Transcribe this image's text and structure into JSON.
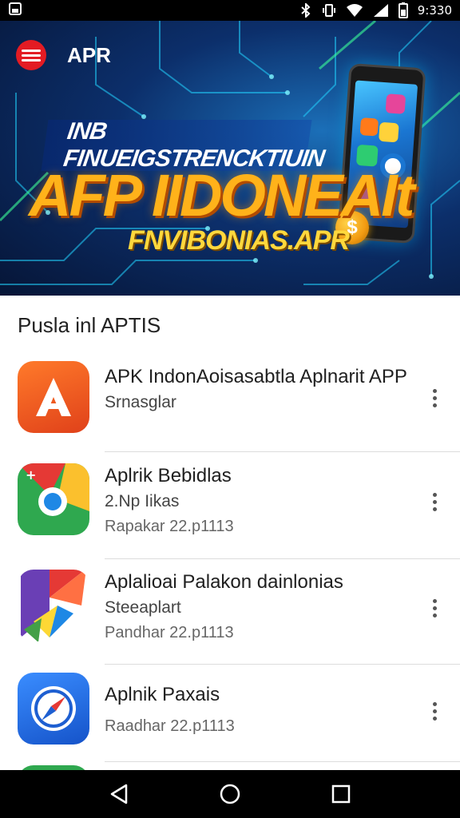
{
  "status_bar": {
    "time": "9:330",
    "icons": [
      "screenshot-icon",
      "bluetooth-icon",
      "vibrate-icon",
      "wifi-icon",
      "signal-icon",
      "battery-icon"
    ]
  },
  "hero": {
    "app_title": "APR",
    "line1": "INB FINUEIGSTRENCKTIUIN",
    "line2": "AFP IIDONEAIt",
    "line3": "FNVIBONIAS.APR",
    "accent_color": "#ffb21a",
    "logo_color": "#e31b23"
  },
  "section": {
    "title": "Pusla inl APTIS"
  },
  "apps": [
    {
      "name": "APK IndonAoisasabtla Aplnarit APP",
      "subtitle": "Srnasglar",
      "date": "",
      "icon": "apk-a-icon"
    },
    {
      "name": "Aplrik Bebidlas",
      "subtitle": "2.Np Iikas",
      "date": "Rapakar 22.p1113",
      "icon": "chrome-like-icon"
    },
    {
      "name": "Aplalioai Palakon dainlonias",
      "subtitle": "Steeaplart",
      "date": "Pandhar 22.p1113",
      "icon": "play-store-like-icon"
    },
    {
      "name": "Aplnik Paxais",
      "subtitle": "",
      "date": "Raadhar 22.p1113",
      "icon": "compass-icon"
    }
  ],
  "nav": {
    "icons": [
      "back-icon",
      "home-icon",
      "recents-icon"
    ]
  }
}
